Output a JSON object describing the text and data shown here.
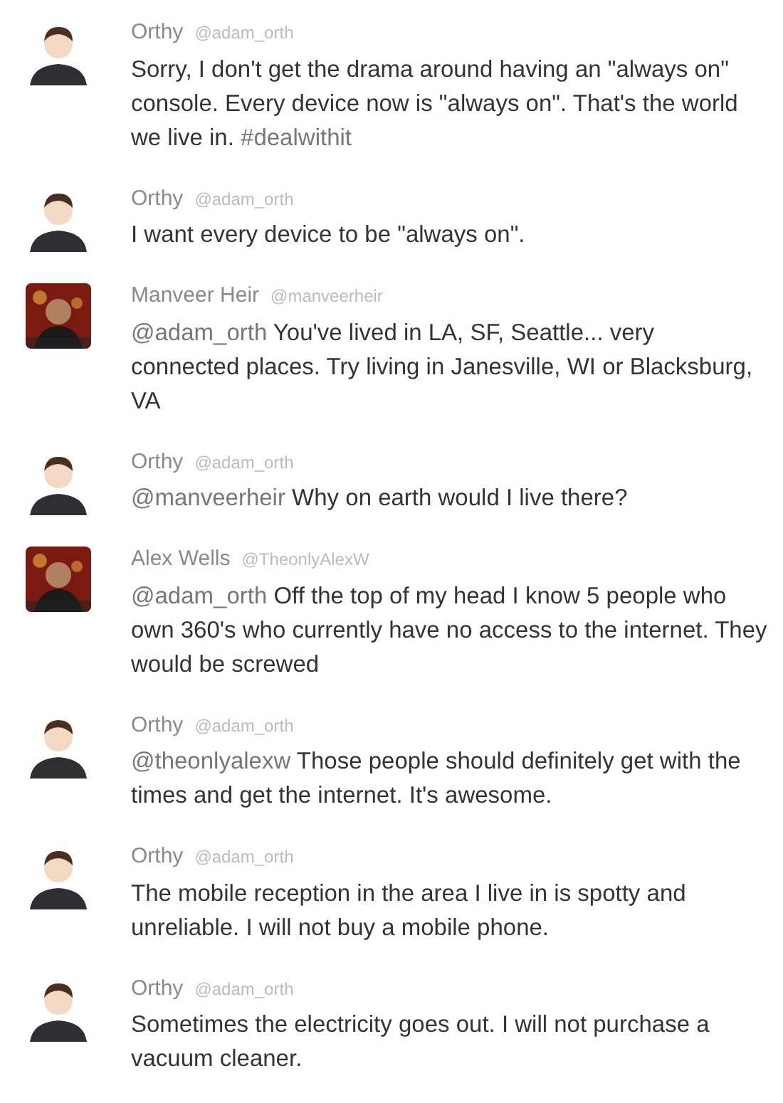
{
  "tweets": [
    {
      "name": "Orthy",
      "handle": "@adam_orth",
      "avatar": {
        "kind": "cartoon"
      },
      "body": [
        {
          "kind": "plain",
          "text": "Sorry, I don't get the drama around having an \"always on\" console. Every device now is \"always on\". That's the world we live in. "
        },
        {
          "kind": "link",
          "text": "#dealwithit"
        }
      ]
    },
    {
      "name": "Orthy",
      "handle": "@adam_orth",
      "avatar": {
        "kind": "cartoon"
      },
      "body": [
        {
          "kind": "plain",
          "text": "I want every device to be \"always on\"."
        }
      ]
    },
    {
      "name": "Manveer Heir",
      "handle": "@manveerheir",
      "body": [
        {
          "kind": "link",
          "text": "@adam_orth"
        },
        {
          "kind": "plain",
          "text": " You've lived in LA, SF, Seattle... very connected places. Try living in Janesville, WI or Blacksburg, VA"
        }
      ]
    },
    {
      "name": "Orthy",
      "handle": "@adam_orth",
      "avatar": {
        "kind": "cartoon"
      },
      "body": [
        {
          "kind": "link",
          "text": "@manveerheir"
        },
        {
          "kind": "plain",
          "text": " Why on earth would I live there?"
        }
      ]
    },
    {
      "name": "Alex Wells",
      "handle": "@TheonlyAlexW",
      "body": [
        {
          "kind": "link",
          "text": "@adam_orth"
        },
        {
          "kind": "plain",
          "text": " Off the top of my head I know 5 people who own 360's who currently have no access to the internet. They would be screwed"
        }
      ]
    },
    {
      "name": "Orthy",
      "handle": "@adam_orth",
      "avatar": {
        "kind": "cartoon"
      },
      "body": [
        {
          "kind": "link",
          "text": "@theonlyalexw"
        },
        {
          "kind": "plain",
          "text": " Those people should definitely get with the times and get the internet. It's awesome."
        }
      ]
    },
    {
      "name": "Orthy",
      "handle": "@adam_orth",
      "avatar": {
        "kind": "cartoon"
      },
      "body": [
        {
          "kind": "plain",
          "text": "The mobile reception in the area I live in is spotty and unreliable. I will not buy a mobile phone."
        }
      ]
    },
    {
      "name": "Orthy",
      "handle": "@adam_orth",
      "avatar": {
        "kind": "cartoon"
      },
      "body": [
        {
          "kind": "plain",
          "text": "Sometimes the electricity goes out. I will not purchase a vacuum cleaner."
        }
      ]
    }
  ]
}
